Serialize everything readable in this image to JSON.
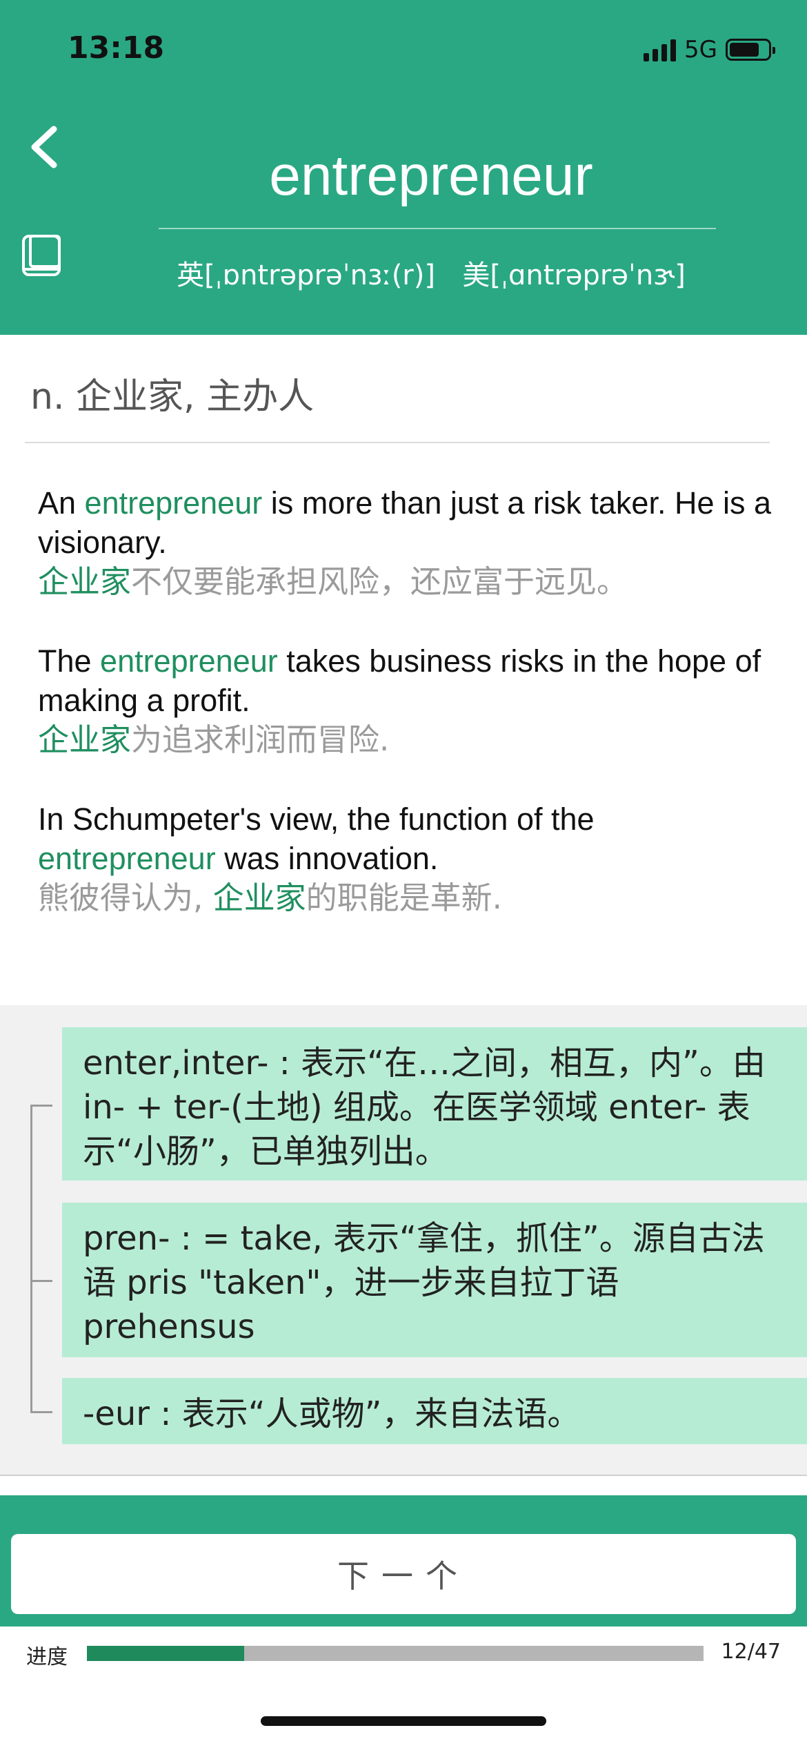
{
  "status_bar": {
    "time": "13:18",
    "network": "5G",
    "battery_level": 0.78
  },
  "header": {
    "word": "entrepreneur",
    "phonetic_uk": "英[ˌɒntrəprəˈnɜː(r)]",
    "phonetic_us": "美[ˌɑntrəprəˈnɝ]",
    "colors": {
      "header_bg": "#2aa883",
      "highlight": "#1f8f5f"
    },
    "icons": {
      "back": "chevron-left-icon",
      "wordbook": "book-icon"
    }
  },
  "definition": "n. 企业家, 主办人",
  "examples": [
    {
      "en": {
        "pre": "An ",
        "hl": "entrepreneur",
        "post": " is more than just a risk taker. He is a visionary."
      },
      "zh": {
        "pre": "",
        "hl": "企业家",
        "post": "不仅要能承担风险，还应富于远见。"
      }
    },
    {
      "en": {
        "pre": "The ",
        "hl": "entrepreneur",
        "post": " takes business risks in the hope of making a profit."
      },
      "zh": {
        "pre": "",
        "hl": "企业家",
        "post": "为追求利润而冒险."
      }
    },
    {
      "en": {
        "pre": "In Schumpeter's view, the function of the ",
        "hl": "entrepreneur",
        "post": " was innovation."
      },
      "zh": {
        "pre": "熊彼得认为, ",
        "hl": "企业家",
        "post": "的职能是革新."
      }
    }
  ],
  "etymology": [
    "enter,inter- : 表示“在…之间，相互，内”。由 in- + ter-(土地) 组成。在医学领域 enter- 表示“小肠”，已单独列出。",
    "pren- : = take, 表示“拿住，抓住”。源自古法语 pris \"taken\"，进一步来自拉丁语 prehensus",
    "-eur : 表示“人或物”，来自法语。"
  ],
  "next_button": "下一个",
  "progress": {
    "label": "进度",
    "current": 12,
    "total": 47,
    "text": "12/47"
  }
}
